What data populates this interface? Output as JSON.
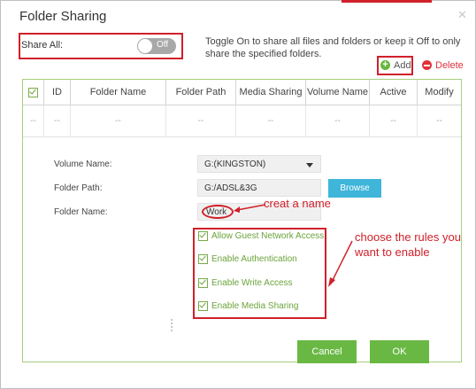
{
  "dialog": {
    "title": "Folder Sharing",
    "close_glyph": "✕"
  },
  "share_all": {
    "label": "Share All:",
    "toggle_text": "Off",
    "description": "Toggle On to share all files and folders or keep it Off to only share the specified folders."
  },
  "actions": {
    "add": "Add",
    "delete": "Delete"
  },
  "table": {
    "columns": [
      "ID",
      "Folder Name",
      "Folder Path",
      "Media Sharing",
      "Volume Name",
      "Active",
      "Modify"
    ],
    "empty_row": [
      "--",
      "--",
      "--",
      "--",
      "--",
      "--",
      "--",
      "--"
    ]
  },
  "form": {
    "volume_label": "Volume Name:",
    "volume_value": "G:(KINGSTON)",
    "path_label": "Folder Path:",
    "path_value": "G:/ADSL&3G",
    "browse": "Browse",
    "name_label": "Folder Name:",
    "name_value": "Work",
    "options": [
      {
        "label": "Allow Guest Network Access",
        "checked": true
      },
      {
        "label": "Enable Authentication",
        "checked": true
      },
      {
        "label": "Enable Write Access",
        "checked": true
      },
      {
        "label": "Enable Media Sharing",
        "checked": true
      }
    ],
    "cancel": "Cancel",
    "ok": "OK"
  },
  "annotations": {
    "name_note": "creat a name",
    "rules_note_1": "choose the rules you",
    "rules_note_2": "want to enable"
  },
  "colors": {
    "accent_green": "#6ab844",
    "annotation_red": "#d0202a",
    "browse_blue": "#3fb5d9"
  }
}
